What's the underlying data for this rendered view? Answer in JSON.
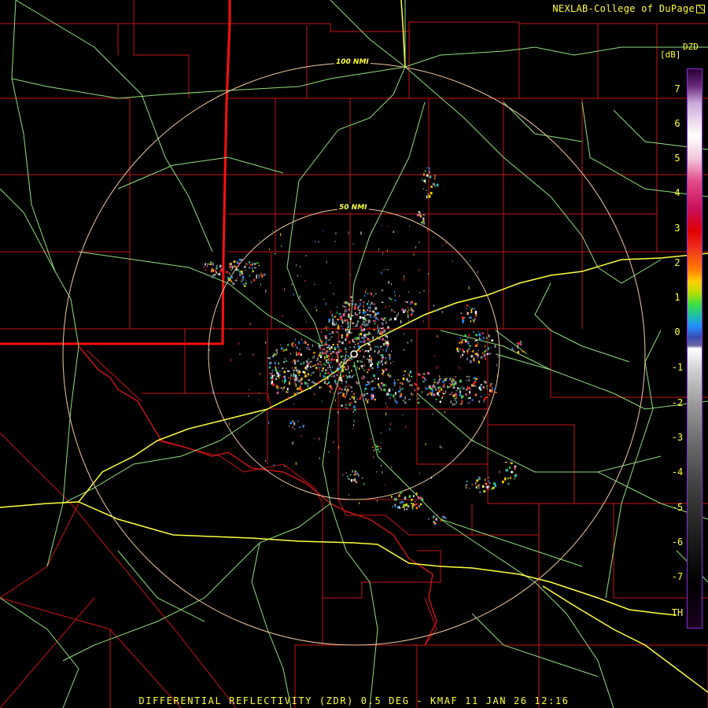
{
  "credit": {
    "text": "NEXLAB-College of DuPage",
    "logo_icon": "cod-logo-icon"
  },
  "legend": {
    "product": "DZD",
    "units": "[dB]",
    "ticks": [
      "7",
      "6",
      "5",
      "4",
      "3",
      "2",
      "1",
      "0",
      "-1",
      "-2",
      "-3",
      "-4",
      "-5",
      "-6",
      "-7",
      "TH"
    ]
  },
  "range_rings": {
    "outer_label": "100 NMI",
    "inner_label": "50 NMI"
  },
  "caption": {
    "text": "DIFFERENTIAL REFLECTIVITY (ZDR) 0.5 DEG - KMAF 11 JAN 26 12:16"
  },
  "colors": {
    "background": "#000000",
    "county_lines": "#c81414",
    "state_line": "#ff1010",
    "roads": "#8fe07a",
    "interstates": "#ffff40",
    "range_rings": "#f0c8a0",
    "text": "#ffff33"
  }
}
